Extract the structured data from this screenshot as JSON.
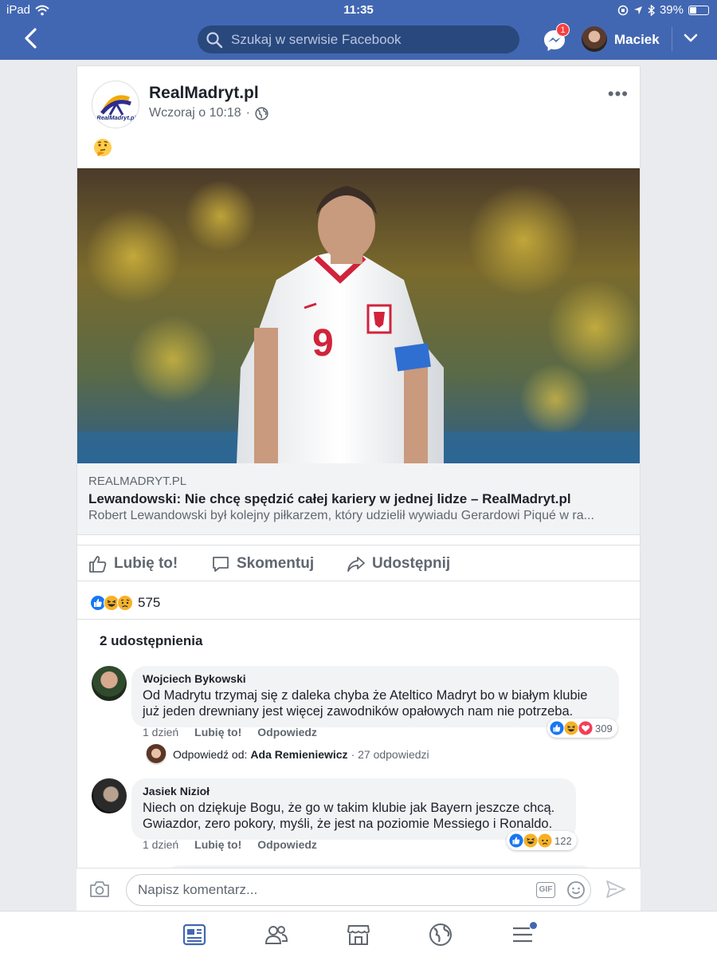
{
  "status_bar": {
    "device": "iPad",
    "time": "11:35",
    "battery": "39%",
    "battery_level": 0.39
  },
  "header": {
    "search_placeholder": "Szukaj w serwisie Facebook",
    "messenger_badge": "1",
    "user_name": "Maciek"
  },
  "post": {
    "page_name": "RealMadryt.pl",
    "logo_text": "RealMadryt.pl",
    "timestamp": "Wczoraj o 10:18",
    "separator": "·",
    "link": {
      "domain": "REALMADRYT.PL",
      "title": "Lewandowski: Nie chcę spędzić całej kariery w jednej lidze – RealMadryt.pl",
      "description": "Robert Lewandowski był kolejny piłkarzem, który udzielił wywiadu Gerardowi Piqué w ra..."
    },
    "actions": {
      "like": "Lubię to!",
      "comment": "Skomentuj",
      "share": "Udostępnij"
    },
    "reaction_count": "575",
    "shares": "2 udostępnienia",
    "photo_number": "9"
  },
  "comments": [
    {
      "author": "Wojciech Bykowski",
      "text_lines": [
        "Od Madrytu trzymaj się z daleka chyba że Ateltico Madryt  bo w białym klubie",
        "już jeden drewniany jest więcej zawodników opałowych nam nie potrzeba."
      ],
      "time": "1 dzień",
      "like": "Lubię to!",
      "reply": "Odpowiedz",
      "reactions": "309",
      "reply_summary": {
        "label": "Odpowiedź od:",
        "name": "Ada Remieniewicz",
        "count": "· 27 odpowiedzi"
      }
    },
    {
      "author": "Jasiek Nizioł",
      "text_lines": [
        "Niech on dziękuje Bogu, że go w takim klubie jak Bayern jeszcze chcą.",
        "Gwiazdor, zero pokory, myśli, że jest na poziomie Messiego i Ronaldo."
      ],
      "time": "1 dzień",
      "like": "Lubię to!",
      "reply": "Odpowiedz",
      "reactions": "122"
    }
  ],
  "composer": {
    "placeholder": "Napisz komentarz...",
    "gif": "GIF"
  },
  "colors": {
    "brand": "#4267b2",
    "brand_dark": "#29487d",
    "like_blue": "#1877f2",
    "heart_red": "#f33e58",
    "badge_red": "#fa3e3e"
  },
  "icons": [
    "back-icon",
    "search-icon",
    "messenger-icon",
    "chevron-down-icon",
    "globe-icon",
    "more-icon",
    "thinking-emoji",
    "like-icon",
    "comment-icon",
    "share-icon",
    "camera-icon",
    "gif-icon",
    "smiley-icon",
    "send-icon",
    "news-feed-icon",
    "friends-icon",
    "marketplace-icon",
    "notifications-globe-icon",
    "menu-icon"
  ]
}
